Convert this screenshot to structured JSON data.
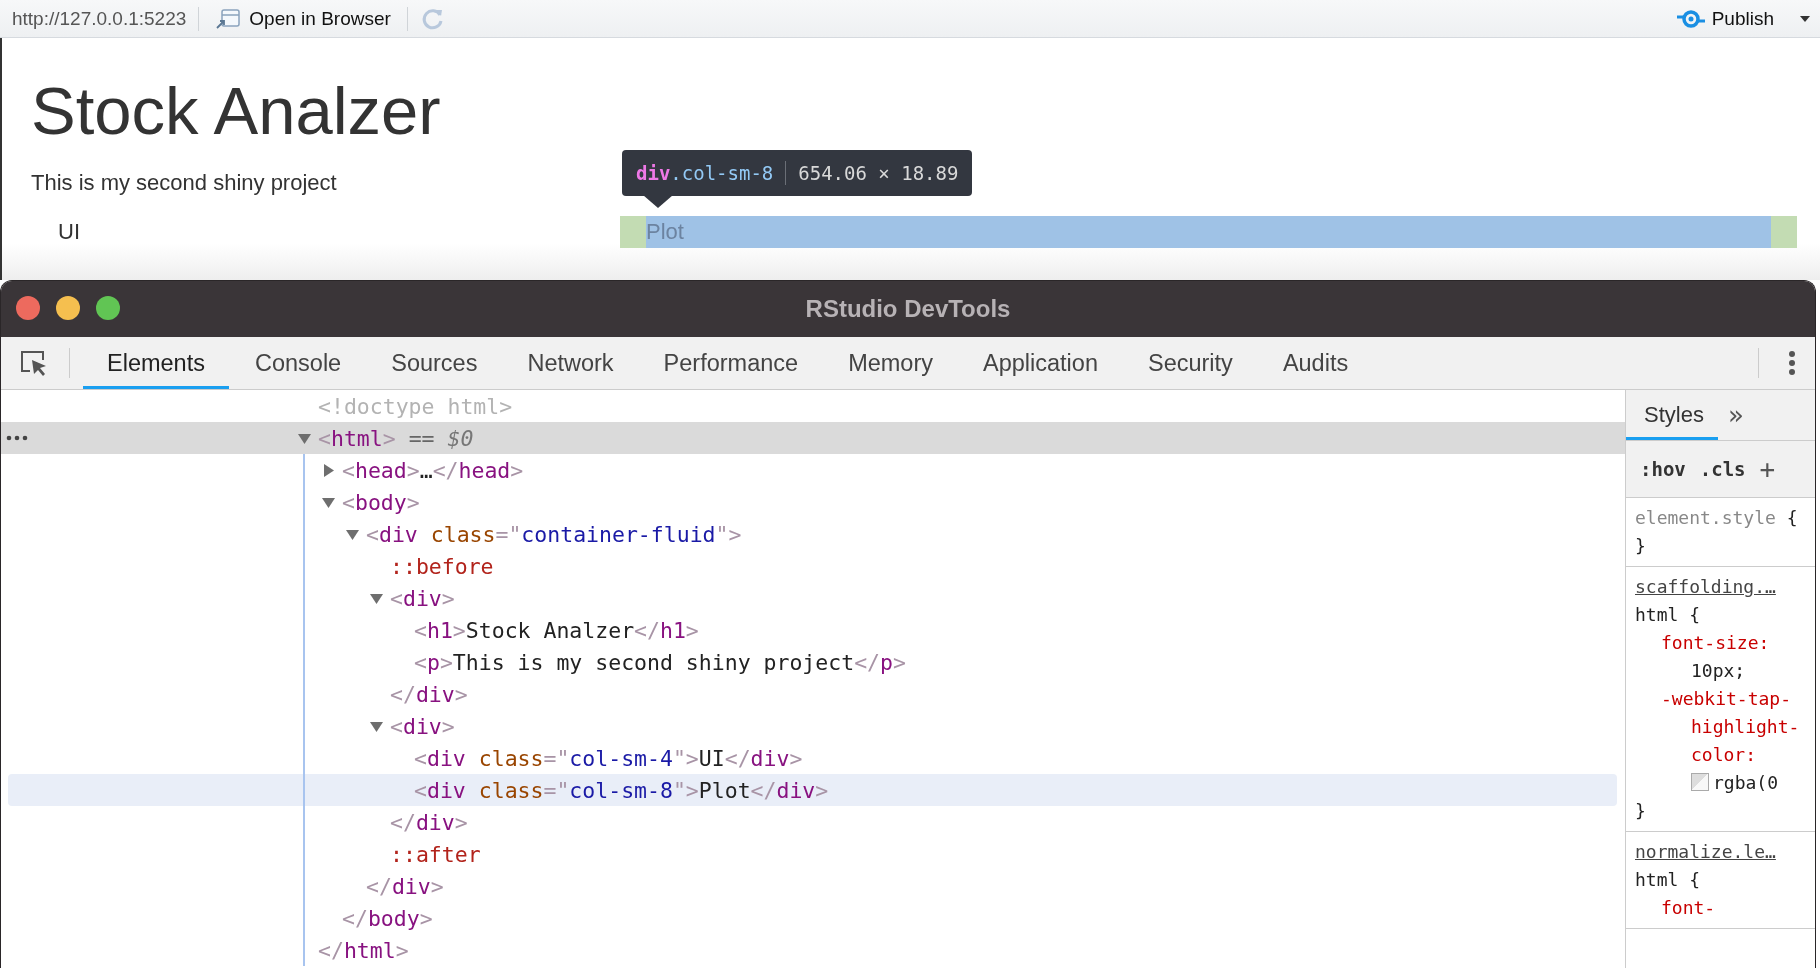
{
  "viewer_toolbar": {
    "url": "http://127.0.0.1:5223",
    "open_in_browser": "Open in Browser",
    "publish": "Publish"
  },
  "app_page": {
    "title": "Stock Analzer",
    "subtitle": "This is my second shiny project",
    "columns": [
      {
        "label": "UI",
        "highlighted": false
      },
      {
        "label": "Plot",
        "highlighted": true
      }
    ],
    "inspect_tooltip": {
      "tag": "div",
      "class_name": ".col-sm-8",
      "size": "654.06 × 18.89"
    }
  },
  "devtools": {
    "title": "RStudio DevTools",
    "tabs": [
      {
        "label": "Elements",
        "selected": true
      },
      {
        "label": "Console",
        "selected": false
      },
      {
        "label": "Sources",
        "selected": false
      },
      {
        "label": "Network",
        "selected": false
      },
      {
        "label": "Performance",
        "selected": false
      },
      {
        "label": "Memory",
        "selected": false
      },
      {
        "label": "Application",
        "selected": false
      },
      {
        "label": "Security",
        "selected": false
      },
      {
        "label": "Audits",
        "selected": false
      }
    ],
    "dom_tree": [
      {
        "tokens": [
          {
            "kind": "doctype",
            "text": "<!doctype html>"
          }
        ],
        "selected": false,
        "hovered": false
      },
      {
        "tokens": [
          {
            "kind": "punct",
            "text": "<"
          },
          {
            "kind": "tag",
            "text": "html"
          },
          {
            "kind": "punct",
            "text": ">"
          },
          {
            "kind": "marker",
            "text": " == "
          },
          {
            "kind": "var",
            "text": "$0"
          }
        ],
        "selected": true,
        "hovered": false,
        "expanded": true,
        "close": [
          {
            "kind": "punct",
            "text": "</"
          },
          {
            "kind": "tag",
            "text": "html"
          },
          {
            "kind": "punct",
            "text": ">"
          }
        ],
        "children": [
          {
            "tokens": [
              {
                "kind": "punct",
                "text": "<"
              },
              {
                "kind": "tag",
                "text": "head"
              },
              {
                "kind": "punct",
                "text": ">"
              },
              {
                "kind": "text",
                "text": "…"
              },
              {
                "kind": "punct",
                "text": "</"
              },
              {
                "kind": "tag",
                "text": "head"
              },
              {
                "kind": "punct",
                "text": ">"
              }
            ],
            "selected": false,
            "hovered": false,
            "expanded": false
          },
          {
            "tokens": [
              {
                "kind": "punct",
                "text": "<"
              },
              {
                "kind": "tag",
                "text": "body"
              },
              {
                "kind": "punct",
                "text": ">"
              }
            ],
            "selected": false,
            "hovered": false,
            "expanded": true,
            "close": [
              {
                "kind": "punct",
                "text": "</"
              },
              {
                "kind": "tag",
                "text": "body"
              },
              {
                "kind": "punct",
                "text": ">"
              }
            ],
            "children": [
              {
                "tokens": [
                  {
                    "kind": "punct",
                    "text": "<"
                  },
                  {
                    "kind": "tag",
                    "text": "div"
                  },
                  {
                    "kind": "attr",
                    "text": " class"
                  },
                  {
                    "kind": "punct",
                    "text": "=\""
                  },
                  {
                    "kind": "value",
                    "text": "container-fluid"
                  },
                  {
                    "kind": "punct",
                    "text": "\">"
                  }
                ],
                "selected": false,
                "hovered": false,
                "expanded": true,
                "close": [
                  {
                    "kind": "punct",
                    "text": "</"
                  },
                  {
                    "kind": "tag",
                    "text": "div"
                  },
                  {
                    "kind": "punct",
                    "text": ">"
                  }
                ],
                "children": [
                  {
                    "tokens": [
                      {
                        "kind": "pseudo",
                        "text": "::before"
                      }
                    ],
                    "selected": false,
                    "hovered": false
                  },
                  {
                    "tokens": [
                      {
                        "kind": "punct",
                        "text": "<"
                      },
                      {
                        "kind": "tag",
                        "text": "div"
                      },
                      {
                        "kind": "punct",
                        "text": ">"
                      }
                    ],
                    "selected": false,
                    "hovered": false,
                    "expanded": true,
                    "close": [
                      {
                        "kind": "punct",
                        "text": "</"
                      },
                      {
                        "kind": "tag",
                        "text": "div"
                      },
                      {
                        "kind": "punct",
                        "text": ">"
                      }
                    ],
                    "children": [
                      {
                        "tokens": [
                          {
                            "kind": "punct",
                            "text": "<"
                          },
                          {
                            "kind": "tag",
                            "text": "h1"
                          },
                          {
                            "kind": "punct",
                            "text": ">"
                          },
                          {
                            "kind": "text",
                            "text": "Stock Analzer"
                          },
                          {
                            "kind": "punct",
                            "text": "</"
                          },
                          {
                            "kind": "tag",
                            "text": "h1"
                          },
                          {
                            "kind": "punct",
                            "text": ">"
                          }
                        ],
                        "selected": false,
                        "hovered": false
                      },
                      {
                        "tokens": [
                          {
                            "kind": "punct",
                            "text": "<"
                          },
                          {
                            "kind": "tag",
                            "text": "p"
                          },
                          {
                            "kind": "punct",
                            "text": ">"
                          },
                          {
                            "kind": "text",
                            "text": "This is my second shiny project"
                          },
                          {
                            "kind": "punct",
                            "text": "</"
                          },
                          {
                            "kind": "tag",
                            "text": "p"
                          },
                          {
                            "kind": "punct",
                            "text": ">"
                          }
                        ],
                        "selected": false,
                        "hovered": false
                      }
                    ]
                  },
                  {
                    "tokens": [
                      {
                        "kind": "punct",
                        "text": "<"
                      },
                      {
                        "kind": "tag",
                        "text": "div"
                      },
                      {
                        "kind": "punct",
                        "text": ">"
                      }
                    ],
                    "selected": false,
                    "hovered": false,
                    "expanded": true,
                    "close": [
                      {
                        "kind": "punct",
                        "text": "</"
                      },
                      {
                        "kind": "tag",
                        "text": "div"
                      },
                      {
                        "kind": "punct",
                        "text": ">"
                      }
                    ],
                    "children": [
                      {
                        "tokens": [
                          {
                            "kind": "punct",
                            "text": "<"
                          },
                          {
                            "kind": "tag",
                            "text": "div"
                          },
                          {
                            "kind": "attr",
                            "text": " class"
                          },
                          {
                            "kind": "punct",
                            "text": "=\""
                          },
                          {
                            "kind": "value",
                            "text": "col-sm-4"
                          },
                          {
                            "kind": "punct",
                            "text": "\">"
                          },
                          {
                            "kind": "text",
                            "text": "UI"
                          },
                          {
                            "kind": "punct",
                            "text": "</"
                          },
                          {
                            "kind": "tag",
                            "text": "div"
                          },
                          {
                            "kind": "punct",
                            "text": ">"
                          }
                        ],
                        "selected": false,
                        "hovered": false
                      },
                      {
                        "tokens": [
                          {
                            "kind": "punct",
                            "text": "<"
                          },
                          {
                            "kind": "tag",
                            "text": "div"
                          },
                          {
                            "kind": "attr",
                            "text": " class"
                          },
                          {
                            "kind": "punct",
                            "text": "=\""
                          },
                          {
                            "kind": "value",
                            "text": "col-sm-8"
                          },
                          {
                            "kind": "punct",
                            "text": "\">"
                          },
                          {
                            "kind": "text",
                            "text": "Plot"
                          },
                          {
                            "kind": "punct",
                            "text": "</"
                          },
                          {
                            "kind": "tag",
                            "text": "div"
                          },
                          {
                            "kind": "punct",
                            "text": ">"
                          }
                        ],
                        "selected": false,
                        "hovered": true
                      }
                    ]
                  },
                  {
                    "tokens": [
                      {
                        "kind": "pseudo",
                        "text": "::after"
                      }
                    ],
                    "selected": false,
                    "hovered": false
                  }
                ]
              }
            ]
          }
        ]
      }
    ],
    "styles_pane": {
      "tabs": [
        {
          "label": "Styles",
          "selected": true
        }
      ],
      "more_tabs": "»",
      "filter_buttons": [
        ":hov",
        ".cls",
        "+"
      ],
      "rules": [
        {
          "selector": "element.style",
          "open": "{",
          "close": "}"
        },
        {
          "source": "scaffolding.…",
          "selector": "html",
          "open": "{",
          "close": "}",
          "declarations": [
            {
              "kind": "plain",
              "property": "font-size:",
              "value": "10px;"
            },
            {
              "kind": "color",
              "property": "-webkit-tap-highlight-color:",
              "value": "rgba(0"
            }
          ]
        },
        {
          "source": "normalize.le…",
          "selector": "html",
          "open": "{",
          "declarations": [
            {
              "kind": "plain",
              "property": "font-"
            }
          ]
        }
      ]
    }
  }
}
